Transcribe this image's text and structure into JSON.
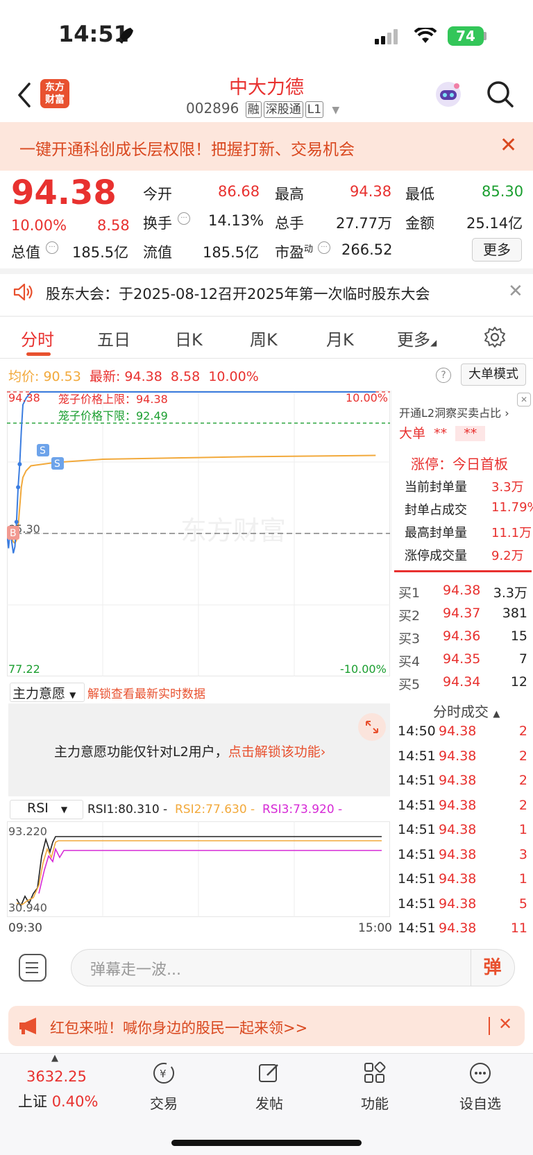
{
  "status": {
    "time": "14:51",
    "battery": "74"
  },
  "header": {
    "logo_line1": "东方",
    "logo_line2": "财富",
    "stock_name": "中大力德",
    "stock_code": "002896",
    "tags": [
      "融",
      "深股通",
      "L1"
    ]
  },
  "promo": {
    "text": "一键开通科创成长层权限！把握打新、交易机会"
  },
  "quote": {
    "price": "94.38",
    "change_pct": "10.00%",
    "change": "8.58",
    "open_label": "今开",
    "open": "86.68",
    "high_label": "最高",
    "high": "94.38",
    "low_label": "最低",
    "low": "85.30",
    "turnover_label": "换手",
    "turnover": "14.13%",
    "volume_label": "总手",
    "volume": "27.77万",
    "amount_label": "金额",
    "amount": "25.14亿",
    "mktcap_label": "总值",
    "mktcap": "185.5亿",
    "float_label": "流值",
    "float": "185.5亿",
    "pe_label": "市盈",
    "pe_sup": "动",
    "pe": "266.52",
    "more": "更多"
  },
  "notice": {
    "text": "股东大会：于2025-08-12召开2025年第一次临时股东大会"
  },
  "tabs": [
    "分时",
    "五日",
    "日K",
    "周K",
    "月K",
    "更多"
  ],
  "infoline": {
    "avg_label": "均价:",
    "avg": "90.53",
    "latest_label": "最新:",
    "latest": "94.38",
    "chg": "8.58",
    "pct": "10.00%",
    "help": "?",
    "big_mode": "大单模式"
  },
  "chart_labels": {
    "top_price": "94.38",
    "top_pct": "10.00%",
    "upper_limit": "笼子价格上限：94.38",
    "lower_limit": "笼子价格下限：92.49",
    "mid_price": "85.30",
    "bottom_price": "77.22",
    "bottom_pct": "-10.00%",
    "watermark": "东方财富",
    "buy_marker": "B",
    "sell_marker": "S"
  },
  "chart_data": {
    "type": "line",
    "title": "",
    "xlabel": "",
    "ylabel": "",
    "x": [
      "09:30",
      "09:31",
      "09:32",
      "09:33",
      "09:34",
      "09:35",
      "09:36",
      "09:37",
      "09:38",
      "09:39",
      "09:40",
      "09:42",
      "09:45",
      "10:00",
      "10:30",
      "11:30",
      "13:30",
      "14:51"
    ],
    "series": [
      {
        "values": [
          85.8,
          84.9,
          86.0,
          85.3,
          84.6,
          85.0,
          86.5,
          88.6,
          90.0,
          92.0,
          93.6,
          94.0,
          94.38,
          94.38,
          94.38,
          94.38,
          94.38,
          94.38
        ]
      },
      {
        "values": [
          85.8,
          85.5,
          85.6,
          85.5,
          85.3,
          85.2,
          85.4,
          86.2,
          87.4,
          88.6,
          89.2,
          89.6,
          89.9,
          90.1,
          90.3,
          90.4,
          90.45,
          90.53
        ]
      }
    ],
    "xlim": [
      "09:30",
      "15:00"
    ],
    "ylim": [
      77.22,
      94.38
    ],
    "ref_price": 85.8,
    "x_ticks": [
      "09:30",
      "15:00"
    ]
  },
  "right_panel": {
    "l2_title": "开通L2洞察买卖占比",
    "big_order_label": "大单",
    "big_order_val1": "**",
    "big_order_val2": "**",
    "limit_title": "涨停：今日首板",
    "stats": [
      {
        "label": "当前封单量",
        "value": "3.3万"
      },
      {
        "label": "封单占成交",
        "value": "11.79%"
      },
      {
        "label": "最高封单量",
        "value": "11.1万"
      },
      {
        "label": "涨停成交量",
        "value": "9.2万"
      }
    ],
    "bids": [
      {
        "label": "买1",
        "price": "94.38",
        "vol": "3.3万"
      },
      {
        "label": "买2",
        "price": "94.37",
        "vol": "381"
      },
      {
        "label": "买3",
        "price": "94.36",
        "vol": "15"
      },
      {
        "label": "买4",
        "price": "94.35",
        "vol": "7"
      },
      {
        "label": "买5",
        "price": "94.34",
        "vol": "12"
      }
    ],
    "ticks_title": "分时成交",
    "ticks": [
      {
        "time": "14:50",
        "price": "94.38",
        "vol": "2"
      },
      {
        "time": "14:51",
        "price": "94.38",
        "vol": "2"
      },
      {
        "time": "14:51",
        "price": "94.38",
        "vol": "2"
      },
      {
        "time": "14:51",
        "price": "94.38",
        "vol": "2"
      },
      {
        "time": "14:51",
        "price": "94.38",
        "vol": "1"
      },
      {
        "time": "14:51",
        "price": "94.38",
        "vol": "3"
      },
      {
        "time": "14:51",
        "price": "94.38",
        "vol": "1"
      },
      {
        "time": "14:51",
        "price": "94.38",
        "vol": "5"
      },
      {
        "time": "14:51",
        "price": "94.38",
        "vol": "11"
      }
    ]
  },
  "main_force": {
    "title": "主力意愿",
    "unlock_link": "解锁查看最新实时数据",
    "panel_text": "主力意愿功能仅针对L2用户，",
    "panel_link": "点击解锁该功能"
  },
  "rsi": {
    "selector": "RSI",
    "rsi1": "RSI1:80.310 -",
    "rsi2": "RSI2:77.630 -",
    "rsi3": "RSI3:73.920 -",
    "top": "93.220",
    "bottom": "30.940",
    "time_start": "09:30",
    "time_end": "15:00",
    "colors": {
      "rsi1": "#222222",
      "rsi2": "#f2a93b",
      "rsi3": "#d62ad6"
    }
  },
  "danmu": {
    "placeholder": "弹幕走一波...",
    "button": "弹"
  },
  "redpack": {
    "text": "红包来啦！喊你身边的股民一起来领>>"
  },
  "bottom_nav": {
    "index_value": "3632.25",
    "index_name": "上证",
    "index_pct": "0.40%",
    "items": [
      "交易",
      "发帖",
      "功能",
      "设自选"
    ]
  },
  "colors": {
    "up": "#e8312f",
    "down": "#1a9e2f",
    "price_line": "#3b7de0",
    "avg_line": "#f2a93b",
    "accent": "#e8512f"
  }
}
